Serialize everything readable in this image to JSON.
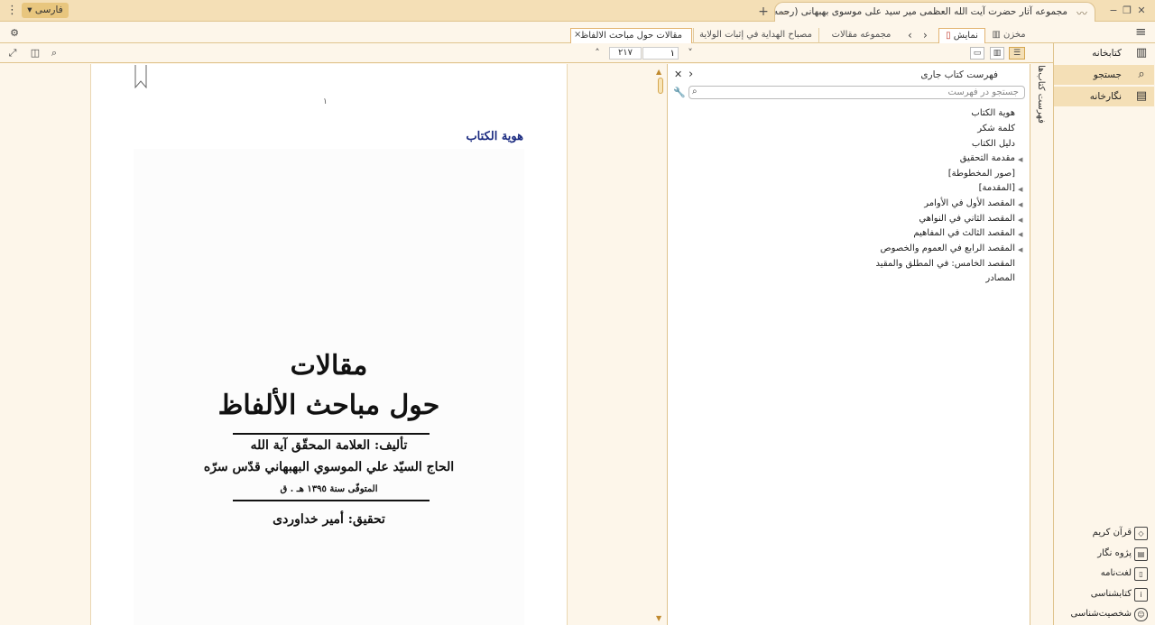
{
  "window": {
    "title": "مجموعه آثار حضرت آیت الله العظمی میر سید علی موسوی بهبهانی (رحمه الله)",
    "language": "فارسی",
    "new_tab": "+",
    "minimize": "−",
    "restore": "❐",
    "close": "✕"
  },
  "tabs": {
    "items": [
      {
        "label": "مقالات حول مباحث الالفاظ"
      },
      {
        "label": "مصباح الهدایة في إثبات الولایة"
      },
      {
        "label": "مجموعه مقالات"
      }
    ],
    "close": "×",
    "view_tab": "نمایش",
    "store_tab": "مخزن"
  },
  "toolbar": {
    "page_current": "۱",
    "page_total": "۲۱۷"
  },
  "document": {
    "page_number": "۱",
    "heading": "هوية الكتاب",
    "cover": {
      "title_line1": "مقالات",
      "title_line2": "حول مباحث الألفاظ",
      "author_line1": "تأليف: العلامة المحقّق آية الله",
      "author_line2": "الحاج السيّد علي الموسوي البهبهاني قدّس سرّه",
      "died": "المتوفّى سنة ١٣٩٥ هـ . ق",
      "editor": "تحقيق: أمير خداوردى"
    }
  },
  "toc": {
    "title": "فهرست کتاب جاری",
    "search_placeholder": "جستجو در فهرست",
    "items": [
      {
        "label": "هوية الكتاب",
        "expandable": false
      },
      {
        "label": "كلمة شكر",
        "expandable": false
      },
      {
        "label": "دليل الكتاب",
        "expandable": false
      },
      {
        "label": "مقدمة التحقيق",
        "expandable": true
      },
      {
        "label": "[صور المخطوطة]",
        "expandable": false
      },
      {
        "label": "[المقدمة]",
        "expandable": true
      },
      {
        "label": "المقصد الأول في الأوامر",
        "expandable": true
      },
      {
        "label": "المقصد الثاني في النواهي",
        "expandable": true
      },
      {
        "label": "المقصد الثالث في المفاهيم",
        "expandable": true
      },
      {
        "label": "المقصد الرابع في العموم والخصوص",
        "expandable": true
      },
      {
        "label": "المقصد الخامس: في المطلق والمقيد",
        "expandable": false
      },
      {
        "label": "المصادر",
        "expandable": false
      }
    ]
  },
  "side_strip": {
    "label": "فهرست کتاب‌ها"
  },
  "nav": {
    "top": [
      {
        "label": "کتابخانه",
        "icon": "library-icon"
      },
      {
        "label": "جستجو",
        "icon": "search-icon"
      },
      {
        "label": "نگارخانه",
        "icon": "gallery-icon"
      }
    ],
    "bottom": [
      {
        "label": "قرآن کریم",
        "icon": "quran-icon"
      },
      {
        "label": "پژوه نگار",
        "icon": "notes-icon"
      },
      {
        "label": "لغت‌نامه",
        "icon": "dictionary-icon"
      },
      {
        "label": "کتابشناسی",
        "icon": "bibliography-icon"
      },
      {
        "label": "شخصیت‌شناسی",
        "icon": "person-icon"
      }
    ]
  },
  "colors": {
    "accent": "#f4dfb6",
    "border": "#e0c48e",
    "heading": "#1a2a80",
    "background": "#fdf6ea"
  }
}
